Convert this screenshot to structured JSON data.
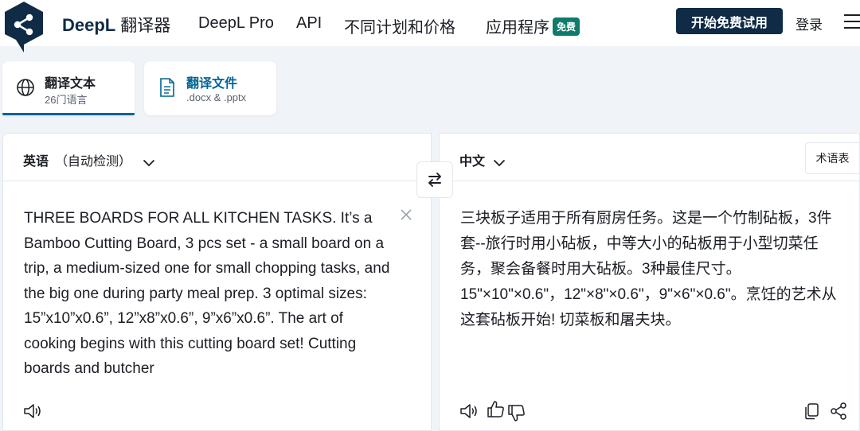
{
  "header": {
    "brand": "DeepL",
    "brand_sub": "翻译器",
    "nav": {
      "pro": "DeepL Pro",
      "api": "API",
      "plans": "不同计划和价格",
      "apps": "应用程序",
      "free_badge": "免费"
    },
    "trial_button": "开始免费试用",
    "login": "登录",
    "icons": {
      "logo": "deepl-logo-icon",
      "menu": "hamburger-menu-icon"
    }
  },
  "mode_tabs": [
    {
      "title": "翻译文本",
      "subtitle": "26门语言",
      "icon": "globe-icon",
      "active": true
    },
    {
      "title": "翻译文件",
      "subtitle": ".docx & .pptx",
      "icon": "document-icon",
      "active": false
    }
  ],
  "source": {
    "language": "英语",
    "detect": "（自动检测）",
    "text": "THREE BOARDS FOR ALL KITCHEN TASKS. It’s a Bamboo Cutting Board, 3 pcs set - a small board on a trip, a medium-sized one for small chopping tasks, and the big one during party meal prep. 3 optimal sizes: 15”x10”x0.6”, 12”x8”x0.6”, 9”x6”x0.6”. The art of cooking begins with this cutting board set! Cutting boards and butcher"
  },
  "target": {
    "language": "中文",
    "glossary": "术语表",
    "text": "三块板子适用于所有厨房任务。这是一个竹制砧板，3件套--旅行时用小砧板，中等大小的砧板用于小型切菜任务，聚会备餐时用大砧板。3种最佳尺寸。15\"×10\"×0.6\"，12\"×8\"×0.6\"，9\"×6\"×0.6\"。烹饪的艺术从这套砧板开始! 切菜板和屠夫块。"
  },
  "colors": {
    "brand_dark": "#0f2b46",
    "accent": "#006494",
    "badge": "#0f7b6c",
    "background": "#f0f4f8"
  }
}
